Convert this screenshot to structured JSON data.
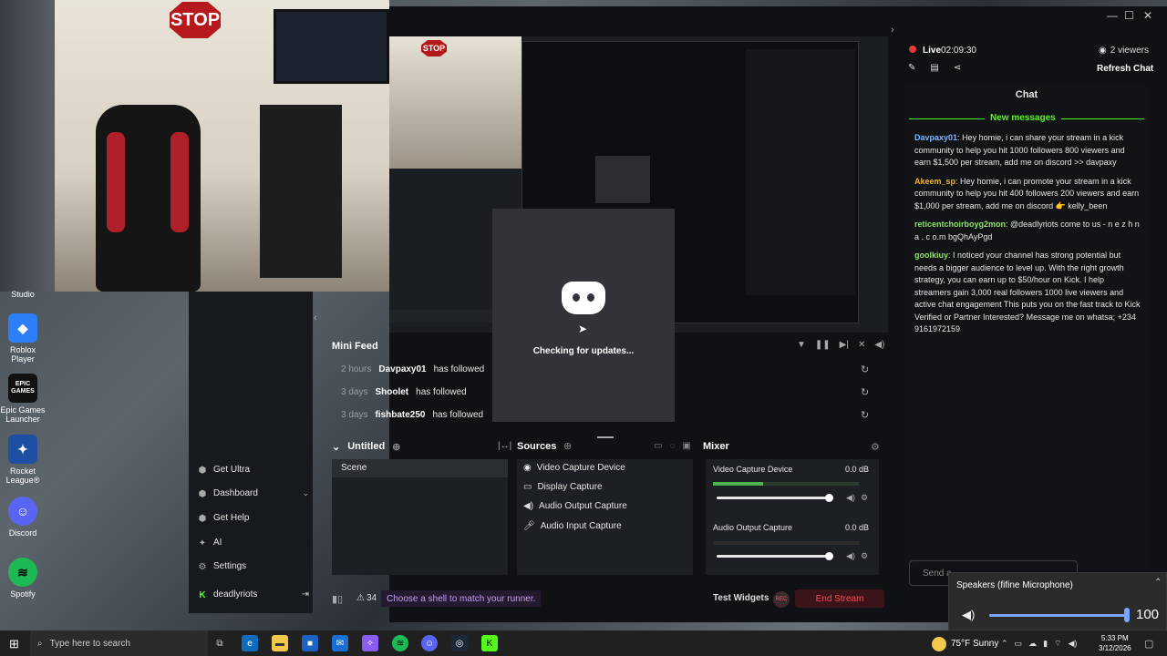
{
  "camera": {
    "sign_text": "STOP"
  },
  "desktop_icons": [
    {
      "label": "Studio"
    },
    {
      "label": "Roblox Player"
    },
    {
      "label": "Epic Games Launcher",
      "logo_text": "EPIC GAMES"
    },
    {
      "label": "Rocket League®"
    },
    {
      "label": "Discord"
    },
    {
      "label": "Spotify"
    }
  ],
  "app": {
    "sidebar": {
      "items": [
        {
          "label": "Get Ultra",
          "icon": "ultra-icon"
        },
        {
          "label": "Dashboard",
          "icon": "dashboard-icon"
        },
        {
          "label": "Get Help",
          "icon": "help-icon"
        },
        {
          "label": "AI",
          "icon": "ai-icon"
        },
        {
          "label": "Settings",
          "icon": "gear-icon"
        }
      ],
      "user": "deadlyriots"
    },
    "minifeed": {
      "title": "Mini Feed",
      "rows": [
        {
          "time": "2 hours",
          "user": "Davpaxy01",
          "action": "has followed"
        },
        {
          "time": "3 days",
          "user": "Shoolet",
          "action": "has followed"
        },
        {
          "time": "3 days",
          "user": "fishbate250",
          "action": "has followed"
        }
      ]
    },
    "discord_popup": {
      "status": "Checking for updates..."
    },
    "scenes": {
      "title": "Untitled",
      "items": [
        "Scene"
      ]
    },
    "sources": {
      "title": "Sources",
      "items": [
        {
          "label": "Video Capture Device",
          "icon": "webcam-icon"
        },
        {
          "label": "Display Capture",
          "icon": "monitor-icon"
        },
        {
          "label": "Audio Output Capture",
          "icon": "speaker-icon"
        },
        {
          "label": "Audio Input Capture",
          "icon": "mic-icon"
        }
      ]
    },
    "mixer": {
      "title": "Mixer",
      "channels": [
        {
          "name": "Video Capture Device",
          "db": "0.0 dB",
          "level": 0.97
        },
        {
          "name": "Audio Output Capture",
          "db": "0.0 dB",
          "level": 0.97
        }
      ]
    },
    "bottom_bar": {
      "alerts_count": "34",
      "tip": "Choose a shell to match your runner.",
      "test_widgets": "Test Widgets",
      "rec": "REC",
      "end_stream": "End Stream"
    },
    "live": {
      "status": "Live",
      "time": "02:09:30",
      "viewers": "2 viewers",
      "refresh": "Refresh Chat"
    },
    "chat": {
      "title": "Chat",
      "new_messages": "New messages",
      "messages": [
        {
          "user": "Davpaxy01",
          "color": "#7ab8ff",
          "text": "Hey homie, i can share your stream in a kick community to help you hit 1000 followers 800 viewers and earn $1,500 per stream, add me on discord >> davpaxy"
        },
        {
          "user": "Akeem_sp",
          "color": "#f2b632",
          "text": "Hey homie, i can promote your stream in a kick community to help you hit 400 followers 200 viewers and earn $1,000 per stream, add me on discord 👉 kelly_been"
        },
        {
          "user": "reticentchoirboyg2mon",
          "color": "#8fe36a",
          "text": "@deadlyriots come to us - n e z h n a . c o.m bgQhAyPgd"
        },
        {
          "user": "goolkiuy",
          "color": "#8fe36a",
          "text": "I noticed your channel has strong potential but needs a bigger audience to level up. With the right growth strategy, you can earn up to $50/hour on Kick. I help streamers gain 3,000 real followers 1000 live viewers and active chat engagement This puts you on the fast track to Kick Verified or Partner Interested? Message me on whatsa; +234 9161972159"
        }
      ],
      "send_placeholder": "Send a"
    }
  },
  "speakers_flyout": {
    "title": "Speakers (fifine Microphone)",
    "volume": "100",
    "level": 1.0
  },
  "taskbar": {
    "search_placeholder": "Type here to search",
    "weather": "75°F  Sunny",
    "time": "5:33 PM",
    "date": "3/12/2026"
  },
  "colors": {
    "accent_green": "#53fc18",
    "live_red": "#e53935",
    "end_stream": "#ff4b58"
  }
}
